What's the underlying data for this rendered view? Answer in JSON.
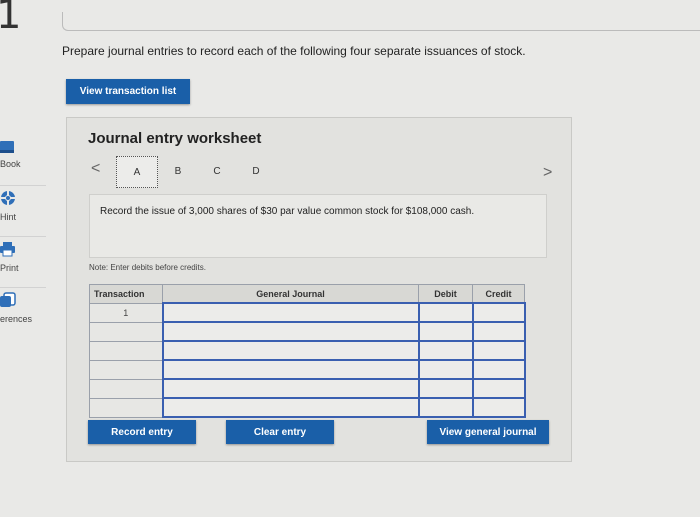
{
  "question_number": "1",
  "prompt": "Prepare journal entries to record each of the following four separate issuances of stock.",
  "buttons": {
    "view_transactions": "View transaction list",
    "record_entry": "Record entry",
    "clear_entry": "Clear entry",
    "view_journal": "View general journal"
  },
  "sidebar": [
    {
      "label": "Book",
      "icon": "book-icon"
    },
    {
      "label": "Hint",
      "icon": "lifebuoy-icon"
    },
    {
      "label": "Print",
      "icon": "printer-icon"
    },
    {
      "label": "erences",
      "icon": "references-icon"
    }
  ],
  "worksheet": {
    "title": "Journal entry worksheet",
    "tabs": [
      "A",
      "B",
      "C",
      "D"
    ],
    "prev_arrow": "<",
    "next_arrow": ">",
    "description": "Record the issue of 3,000 shares of $30 par value common stock for $108,000 cash.",
    "note": "Note: Enter debits before credits.",
    "columns": [
      "Transaction",
      "General Journal",
      "Debit",
      "Credit"
    ],
    "transaction_number": "1"
  },
  "colors": {
    "button": "#1a5fa8",
    "input_border": "#3a5fb0"
  }
}
